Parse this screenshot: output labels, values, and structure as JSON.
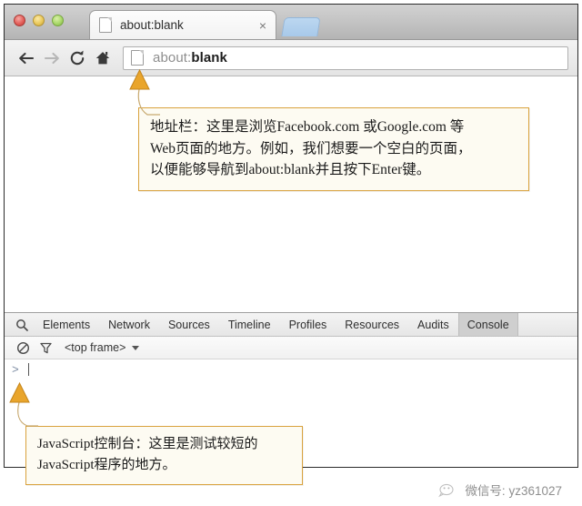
{
  "window": {
    "traffic_lights": [
      {
        "name": "close",
        "color": "#e4605b"
      },
      {
        "name": "minimize",
        "color": "#eac95c"
      },
      {
        "name": "maximize",
        "color": "#a9d96a"
      }
    ]
  },
  "tab_strip": {
    "tab": {
      "favicon": "page-icon",
      "title": "about:blank",
      "close_label": "×"
    },
    "new_tab_label": ""
  },
  "toolbar": {
    "back_icon": "arrow-left-icon",
    "forward_icon": "arrow-right-icon",
    "reload_icon": "reload-icon",
    "home_icon": "home-icon",
    "url": {
      "favicon": "page-icon",
      "scheme": "about:",
      "path": "blank"
    }
  },
  "devtools": {
    "search_icon": "search-icon",
    "tabs": [
      {
        "label": "Elements",
        "active": false
      },
      {
        "label": "Network",
        "active": false
      },
      {
        "label": "Sources",
        "active": false
      },
      {
        "label": "Timeline",
        "active": false
      },
      {
        "label": "Profiles",
        "active": false
      },
      {
        "label": "Resources",
        "active": false
      },
      {
        "label": "Audits",
        "active": false
      },
      {
        "label": "Console",
        "active": true
      }
    ],
    "subbar": {
      "clear_icon": "clear-console-icon",
      "filter_icon": "filter-funnel-icon",
      "frame_selector": "<top frame>"
    },
    "console": {
      "prompt_symbol": ">",
      "input_value": ""
    }
  },
  "callouts": {
    "address": {
      "lines": [
        "地址栏：这里是浏览Facebook.com 或Google.com 等",
        "Web页面的地方。例如，我们想要一个空白的页面，",
        "以便能够导航到about:blank并且按下Enter键。"
      ],
      "border_color": "#d9a23d",
      "background_color": "#fdfbf2",
      "pointer_color": "#e0a22d"
    },
    "console": {
      "lines": [
        "JavaScript控制台：这里是测试较短的",
        "JavaScript程序的地方。"
      ],
      "border_color": "#d9a23d",
      "background_color": "#fdfbf2",
      "pointer_color": "#e0a22d"
    }
  },
  "watermark": {
    "icon": "wechat-icon",
    "text": "微信号: yz361027"
  }
}
